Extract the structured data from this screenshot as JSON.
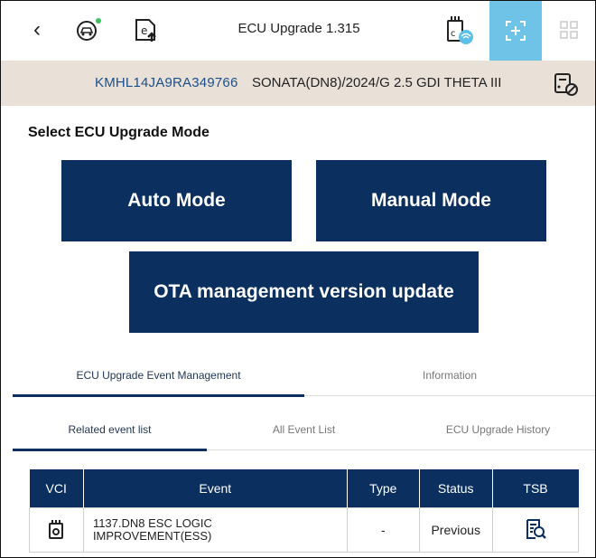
{
  "toolbar": {
    "title": "ECU Upgrade 1.315",
    "icons": [
      "back-icon",
      "vehicle-setting-icon",
      "ecu-upload-icon",
      "vci-wireless-icon",
      "scan-icon",
      "grid-icon"
    ]
  },
  "vehicle": {
    "vin": "KMHL14JA9RA349766",
    "description": "SONATA(DN8)/2024/G 2.5 GDI THETA III"
  },
  "section_title": "Select ECU Upgrade Mode",
  "modes": {
    "auto": "Auto Mode",
    "manual": "Manual Mode",
    "ota": "OTA management version update"
  },
  "tabs": [
    {
      "label": "ECU Upgrade Event Management",
      "active": true
    },
    {
      "label": "Information",
      "active": false
    }
  ],
  "subtabs": [
    {
      "label": "Related event list",
      "active": true
    },
    {
      "label": "All Event List",
      "active": false
    },
    {
      "label": "ECU Upgrade History",
      "active": false
    }
  ],
  "table": {
    "headers": [
      "VCI",
      "Event",
      "Type",
      "Status",
      "TSB"
    ],
    "rows": [
      {
        "event_line1": "1137.DN8 ESC LOGIC",
        "event_line2": "IMPROVEMENT(ESS)",
        "type": "-",
        "status": "Previous"
      }
    ]
  },
  "colors": {
    "primary": "#0b2f5e",
    "accent": "#6fc3e6",
    "vinbar": "#e9e0d8",
    "vin_text": "#1c4f8a"
  }
}
